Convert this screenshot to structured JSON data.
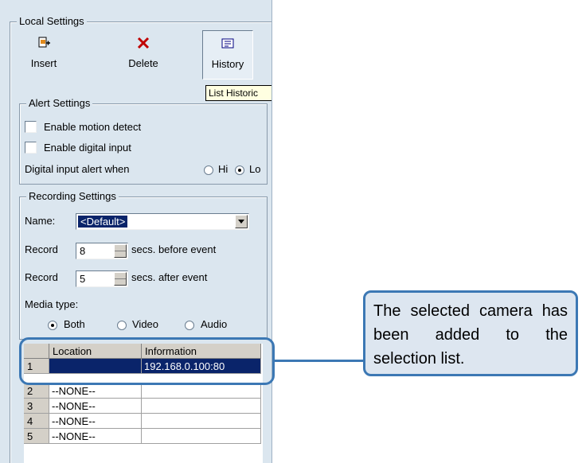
{
  "local_settings": {
    "title": "Local Settings",
    "toolbar": {
      "insert_label": "Insert",
      "delete_label": "Delete",
      "history_label": "History"
    },
    "tooltip": "List Historic"
  },
  "alert_settings": {
    "title": "Alert Settings",
    "enable_motion_detect": "Enable motion detect",
    "enable_digital_input": "Enable digital input",
    "digital_input_alert_label": "Digital input alert when",
    "hi_label": "Hi",
    "lo_label": "Lo",
    "selected_level": "Lo"
  },
  "recording_settings": {
    "title": "Recording Settings",
    "name_label": "Name:",
    "name_value": "<Default>",
    "record_before_label": "Record",
    "record_before_value": "8",
    "record_before_suffix": "secs. before event",
    "record_after_label": "Record",
    "record_after_value": "5",
    "record_after_suffix": "secs. after event",
    "media_type_label": "Media type:",
    "media_both": "Both",
    "media_video": "Video",
    "media_audio": "Audio",
    "selected_media": "Both"
  },
  "camera_list": {
    "headers": [
      "",
      "Location",
      "Information"
    ],
    "rows": [
      {
        "num": "1",
        "location": "",
        "information": "192.168.0.100:80",
        "selected": true
      },
      {
        "num": "2",
        "location": "--NONE--",
        "information": ""
      },
      {
        "num": "3",
        "location": "--NONE--",
        "information": ""
      },
      {
        "num": "4",
        "location": "--NONE--",
        "information": ""
      },
      {
        "num": "5",
        "location": "--NONE--",
        "information": ""
      }
    ]
  },
  "callout": {
    "text": "The selected camera has been added to the selection list."
  },
  "colors": {
    "panel_bg": "#dbe6ef",
    "selection": "#0a246a",
    "callout_border": "#3c78b4",
    "callout_bg": "#dde6f0"
  }
}
